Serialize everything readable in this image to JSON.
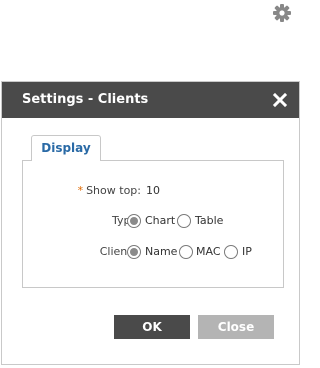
{
  "dialog": {
    "title": "Settings - Clients",
    "tab_label": "Display",
    "fields": {
      "show_top": {
        "required_mark": "*",
        "label": "Show top:",
        "value": "10"
      },
      "type": {
        "label": "Type:",
        "options": [
          {
            "label": "Chart",
            "checked": true
          },
          {
            "label": "Table",
            "checked": false
          }
        ]
      },
      "clients": {
        "label": "Clients:",
        "options": [
          {
            "label": "Name",
            "checked": true
          },
          {
            "label": "MAC",
            "checked": false
          },
          {
            "label": "IP",
            "checked": false
          }
        ]
      }
    },
    "ok_label": "OK",
    "close_label": "Close"
  },
  "icons": {
    "top_right": "gear-icon",
    "dialog_close": "close-icon"
  },
  "colors": {
    "titlebar": "#4a4a4a",
    "tab_text": "#2a6aa6",
    "required": "#e06a00",
    "ok_button": "#4a4a4a",
    "close_button": "#b4b4b4"
  }
}
